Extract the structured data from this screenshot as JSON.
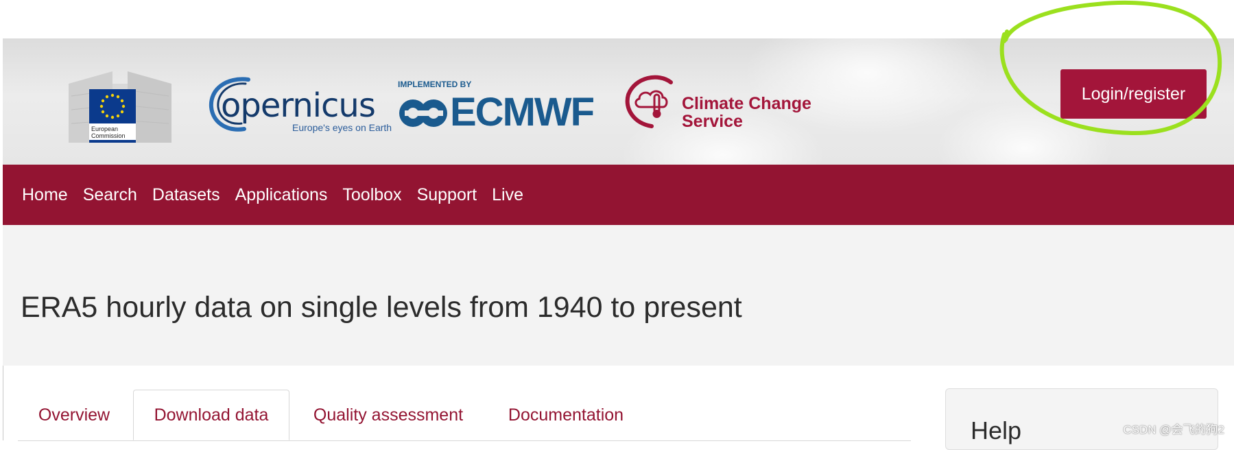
{
  "header": {
    "ec_logo_text": "European Commission",
    "copernicus_name": "opernicus",
    "copernicus_tagline": "Europe's eyes on Earth",
    "ecmwf_implemented": "IMPLEMENTED BY",
    "ecmwf_name": "ECMWF",
    "c3s_line1": "Climate Change",
    "c3s_line2": "Service",
    "login_label": "Login/register"
  },
  "nav": {
    "items": [
      {
        "label": "Home"
      },
      {
        "label": "Search"
      },
      {
        "label": "Datasets"
      },
      {
        "label": "Applications"
      },
      {
        "label": "Toolbox"
      },
      {
        "label": "Support"
      },
      {
        "label": "Live"
      }
    ]
  },
  "page": {
    "title": "ERA5 hourly data on single levels from 1940 to present"
  },
  "tabs": [
    {
      "label": "Overview",
      "active": false
    },
    {
      "label": "Download data",
      "active": true
    },
    {
      "label": "Quality assessment",
      "active": false
    },
    {
      "label": "Documentation",
      "active": false
    }
  ],
  "help": {
    "title": "Help"
  },
  "watermark": "CSDN @会飞的狗2",
  "colors": {
    "brand": "#931432",
    "login_bg": "#a3153a",
    "annotation": "#9be01e"
  }
}
